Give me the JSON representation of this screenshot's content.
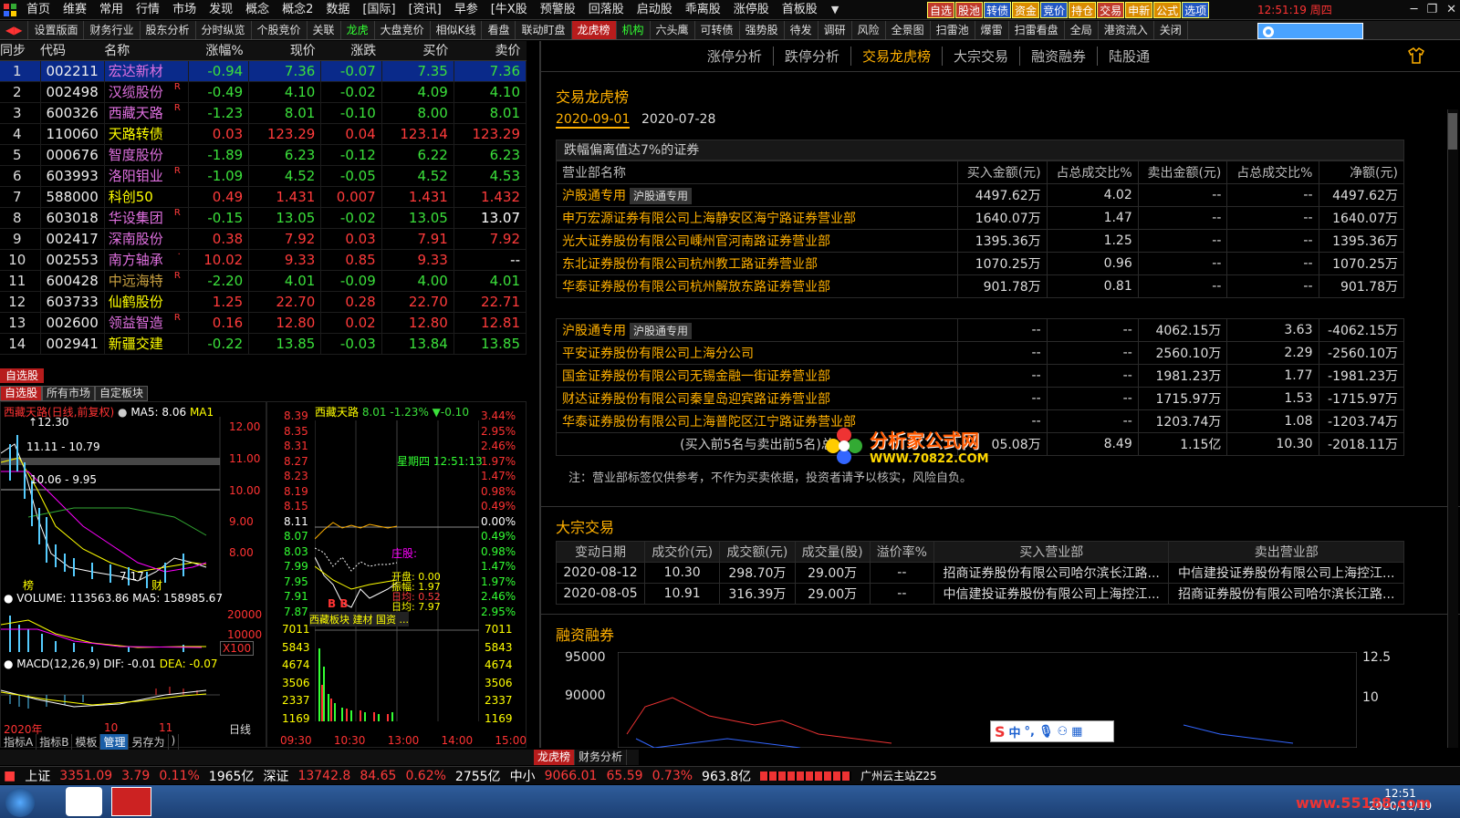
{
  "menu": {
    "items": [
      "首页",
      "维赛",
      "常用",
      "行情",
      "市场",
      "发现",
      "概念",
      "概念2",
      "数据",
      "[国际]",
      "[资讯]",
      "早参",
      "[牛X股",
      "预警股",
      "回落股",
      "启动股",
      "乖离股",
      "涨停股",
      "首板股"
    ],
    "quick_buttons": [
      "自选",
      "股池",
      "转债",
      "资金",
      "竞价",
      "持仓",
      "交易",
      "申新",
      "公式",
      "选项"
    ],
    "time": "12:51:19",
    "weekday": "周四"
  },
  "tabs": [
    "设置版面",
    "财务行业",
    "股东分析",
    "分时纵览",
    "个股竞价",
    "关联",
    "龙虎",
    "大盘竞价",
    "相似K线",
    "看盘",
    "联动盯盘",
    "龙虎榜",
    "机构",
    "六头鹰",
    "可转债",
    "强势股",
    "待发",
    "调研",
    "风险",
    "全景图",
    "扫雷池",
    "爆雷",
    "扫雷看盘",
    "全局",
    "港资流入",
    "关闭"
  ],
  "active_tab": "龙虎榜",
  "quote_table": {
    "headers": [
      "同步",
      "代码",
      "名称",
      "涨幅%",
      "现价",
      "涨跌",
      "买价",
      "卖价"
    ],
    "rows": [
      {
        "idx": "1",
        "code": "002211",
        "name": "宏达新材",
        "r": "",
        "pct": "-0.94",
        "price": "7.36",
        "chg": "-0.07",
        "bid": "7.35",
        "ask": "7.36"
      },
      {
        "idx": "2",
        "code": "002498",
        "name": "汉缆股份",
        "r": "R",
        "pct": "-0.49",
        "price": "4.10",
        "chg": "-0.02",
        "bid": "4.09",
        "ask": "4.10"
      },
      {
        "idx": "3",
        "code": "600326",
        "name": "西藏天路",
        "r": "R",
        "pct": "-1.23",
        "price": "8.01",
        "chg": "-0.10",
        "bid": "8.00",
        "ask": "8.01"
      },
      {
        "idx": "4",
        "code": "110060",
        "name": "天路转债",
        "r": "",
        "pct": "0.03",
        "price": "123.29",
        "chg": "0.04",
        "bid": "123.14",
        "ask": "123.29"
      },
      {
        "idx": "5",
        "code": "000676",
        "name": "智度股份",
        "r": "",
        "pct": "-1.89",
        "price": "6.23",
        "chg": "-0.12",
        "bid": "6.22",
        "ask": "6.23"
      },
      {
        "idx": "6",
        "code": "603993",
        "name": "洛阳钼业",
        "r": "R",
        "pct": "-1.09",
        "price": "4.52",
        "chg": "-0.05",
        "bid": "4.52",
        "ask": "4.53"
      },
      {
        "idx": "7",
        "code": "588000",
        "name": "科创50",
        "r": "",
        "pct": "0.49",
        "price": "1.431",
        "chg": "0.007",
        "bid": "1.431",
        "ask": "1.432"
      },
      {
        "idx": "8",
        "code": "603018",
        "name": "华设集团",
        "r": "R",
        "pct": "-0.15",
        "price": "13.05",
        "chg": "-0.02",
        "bid": "13.05",
        "ask": "13.07"
      },
      {
        "idx": "9",
        "code": "002417",
        "name": "深南股份",
        "r": "",
        "pct": "0.38",
        "price": "7.92",
        "chg": "0.03",
        "bid": "7.91",
        "ask": "7.92"
      },
      {
        "idx": "10",
        "code": "002553",
        "name": "南方轴承",
        "r": "·",
        "pct": "10.02",
        "price": "9.33",
        "chg": "0.85",
        "bid": "9.33",
        "ask": "--"
      },
      {
        "idx": "11",
        "code": "600428",
        "name": "中远海特",
        "r": "R",
        "pct": "-2.20",
        "price": "4.01",
        "chg": "-0.09",
        "bid": "4.00",
        "ask": "4.01"
      },
      {
        "idx": "12",
        "code": "603733",
        "name": "仙鹤股份",
        "r": "",
        "pct": "1.25",
        "price": "22.70",
        "chg": "0.28",
        "bid": "22.70",
        "ask": "22.71"
      },
      {
        "idx": "13",
        "code": "002600",
        "name": "领益智造",
        "r": "R",
        "pct": "0.16",
        "price": "12.80",
        "chg": "0.02",
        "bid": "12.80",
        "ask": "12.81"
      },
      {
        "idx": "14",
        "code": "002941",
        "name": "新疆交建",
        "r": "",
        "pct": "-0.22",
        "price": "13.85",
        "chg": "-0.03",
        "bid": "13.84",
        "ask": "13.85"
      }
    ]
  },
  "watchlist": {
    "title": "自选股",
    "subtabs": [
      "自选股",
      "所有市场",
      "自定板块"
    ]
  },
  "kline": {
    "title": "西藏天路(日线,前复权)",
    "ma": "MA5: 8.06",
    "ma1": "MA1",
    "y_ticks": [
      "12.00",
      "11.00",
      "10.00",
      "9.00",
      "8.00"
    ],
    "high_label": "12.30",
    "range1": "11.11 - 10.79",
    "range2": "10.06 - 9.95",
    "low_label": "7.17",
    "marks": [
      "榜",
      "财"
    ],
    "volume_label": "VOLUME: 113563.86",
    "volume_ma5": "MA5: 158985.67",
    "vol_ticks": [
      "20000",
      "10000"
    ],
    "vol_unit": "X100",
    "macd_label": "MACD(12,26,9)",
    "macd_dif": "DIF: -0.01",
    "macd_dea": "DEA: -0.07",
    "x_labels": [
      "2020年",
      "10",
      "11"
    ],
    "period": "日线",
    "tools": [
      "指标A",
      "指标B",
      "模板",
      "管理",
      "另存为",
      ")"
    ]
  },
  "intraday": {
    "name": "西藏天路",
    "price": "8.01",
    "pct": "-1.23%",
    "chg": "▼-0.10",
    "weekday_time": "星期四 12:51:13",
    "left_ticks": [
      "8.39",
      "8.35",
      "8.31",
      "8.27",
      "8.23",
      "8.19",
      "8.15",
      "8.11",
      "8.07",
      "8.03",
      "7.99",
      "7.95",
      "7.91",
      "7.87"
    ],
    "right_ticks": [
      "3.44%",
      "2.95%",
      "2.46%",
      "1.97%",
      "1.47%",
      "0.98%",
      "0.49%",
      "0.00%",
      "0.49%",
      "0.98%",
      "1.47%",
      "1.97%",
      "2.46%",
      "2.95%"
    ],
    "vol_ticks": [
      "7011",
      "5843",
      "4674",
      "3506",
      "2337",
      "1169"
    ],
    "info_open": "开盘: 0.00",
    "info_vol": "振幅: 1.97",
    "info_amt": "日均: 0.52",
    "info_day": "日均: 7.97",
    "zhuang": "庄股:",
    "bb": "B  B",
    "sector": "西藏板块  建材  国资 ...",
    "x_labels": [
      "09:30",
      "10:30",
      "13:00",
      "14:00",
      "15:00"
    ]
  },
  "bottom_tabs": [
    "龙虎榜",
    "财务分析"
  ],
  "subnav": [
    "涨停分析",
    "跌停分析",
    "交易龙虎榜",
    "大宗交易",
    "融资融券",
    "陆股通"
  ],
  "subnav_active": "交易龙虎榜",
  "lhb": {
    "title": "交易龙虎榜",
    "dates": [
      "2020-09-01",
      "2020-07-28"
    ],
    "caption": "跌幅偏离值达7%的证券",
    "headers": [
      "营业部名称",
      "买入金额(元)",
      "占总成交比%",
      "卖出金额(元)",
      "占总成交比%",
      "净额(元)"
    ],
    "buy_rows": [
      {
        "org": "沪股通专用",
        "tag": "沪股通专用",
        "buy": "4497.62万",
        "buy_pct": "4.02",
        "sell": "--",
        "sell_pct": "--",
        "net": "4497.62万"
      },
      {
        "org": "申万宏源证券有限公司上海静安区海宁路证券营业部",
        "tag": "",
        "buy": "1640.07万",
        "buy_pct": "1.47",
        "sell": "--",
        "sell_pct": "--",
        "net": "1640.07万"
      },
      {
        "org": "光大证券股份有限公司嵊州官河南路证券营业部",
        "tag": "",
        "buy": "1395.36万",
        "buy_pct": "1.25",
        "sell": "--",
        "sell_pct": "--",
        "net": "1395.36万"
      },
      {
        "org": "东北证券股份有限公司杭州教工路证券营业部",
        "tag": "",
        "buy": "1070.25万",
        "buy_pct": "0.96",
        "sell": "--",
        "sell_pct": "--",
        "net": "1070.25万"
      },
      {
        "org": "华泰证券股份有限公司杭州解放东路证券营业部",
        "tag": "",
        "buy": "901.78万",
        "buy_pct": "0.81",
        "sell": "--",
        "sell_pct": "--",
        "net": "901.78万"
      }
    ],
    "sell_rows": [
      {
        "org": "沪股通专用",
        "tag": "沪股通专用",
        "buy": "--",
        "buy_pct": "--",
        "sell": "4062.15万",
        "sell_pct": "3.63",
        "net": "-4062.15万"
      },
      {
        "org": "平安证券股份有限公司上海分公司",
        "tag": "",
        "buy": "--",
        "buy_pct": "--",
        "sell": "2560.10万",
        "sell_pct": "2.29",
        "net": "-2560.10万"
      },
      {
        "org": "国金证券股份有限公司无锡金融一街证券营业部",
        "tag": "",
        "buy": "--",
        "buy_pct": "--",
        "sell": "1981.23万",
        "sell_pct": "1.77",
        "net": "-1981.23万"
      },
      {
        "org": "财达证券股份有限公司秦皇岛迎宾路证券营业部",
        "tag": "",
        "buy": "--",
        "buy_pct": "--",
        "sell": "1715.97万",
        "sell_pct": "1.53",
        "net": "-1715.97万"
      },
      {
        "org": "华泰证券股份有限公司上海普陀区江宁路证券营业部",
        "tag": "",
        "buy": "--",
        "buy_pct": "--",
        "sell": "1203.74万",
        "sell_pct": "1.08",
        "net": "-1203.74万"
      }
    ],
    "total": {
      "label": "(买入前5名与卖出前5名)总",
      "buy": "05.08万",
      "buy_pct": "8.49",
      "sell": "1.15亿",
      "sell_pct": "10.30",
      "net": "-2018.11万"
    },
    "note": "注：营业部标签仅供参考，不作为买卖依据，投资者请予以核实，风险自负。"
  },
  "watermark": {
    "title": "分析家公式网",
    "url": "WWW.70822.COM"
  },
  "dzjy": {
    "title": "大宗交易",
    "headers": [
      "变动日期",
      "成交价(元)",
      "成交额(元)",
      "成交量(股)",
      "溢价率%",
      "买入营业部",
      "卖出营业部"
    ],
    "rows": [
      [
        "2020-08-12",
        "10.30",
        "298.70万",
        "29.00万",
        "--",
        "招商证券股份有限公司哈尔滨长江路...",
        "中信建投证券股份有限公司上海控江..."
      ],
      [
        "2020-08-05",
        "10.91",
        "316.39万",
        "29.00万",
        "--",
        "中信建投证券股份有限公司上海控江...",
        "招商证券股份有限公司哈尔滨长江路..."
      ]
    ]
  },
  "rzrq": {
    "title": "融资融券",
    "left_ticks": [
      "95000",
      "90000"
    ],
    "right_ticks": [
      "12.5",
      "10"
    ]
  },
  "status": {
    "sh_label": "上证",
    "sh_val": "3351.09",
    "sh_chg": "3.79",
    "sh_pct": "0.11%",
    "sh_amt": "1965亿",
    "sz_label": "深证",
    "sz_val": "13742.8",
    "sz_chg": "84.65",
    "sz_pct": "0.62%",
    "sz_amt": "2755亿",
    "zx_label": "中小",
    "zx_val": "9066.01",
    "zx_chg": "65.59",
    "zx_pct": "0.73%",
    "zx_amt": "963.8亿",
    "server": "广州云主站Z25"
  },
  "taskbar": {
    "time": "12:51",
    "date": "2020/11/19",
    "site": "www.55188.com"
  },
  "colors": {
    "up": "#ff3b3b",
    "down": "#3be03b",
    "accent": "#ffb000",
    "active_tab": "#b71c1c"
  }
}
